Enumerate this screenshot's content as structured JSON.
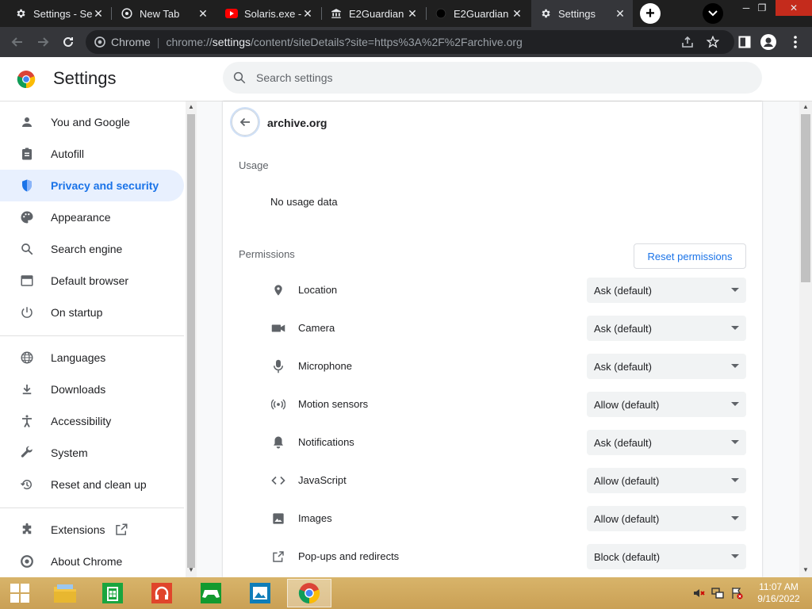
{
  "tabs": [
    {
      "title": "Settings - Se",
      "icon": "gear-icon"
    },
    {
      "title": "New Tab",
      "icon": "chrome-icon"
    },
    {
      "title": "Solaris.exe -",
      "icon": "youtube-icon"
    },
    {
      "title": "E2Guardian",
      "icon": "bank-icon"
    },
    {
      "title": "E2Guardian",
      "icon": "github-icon"
    },
    {
      "title": "Settings",
      "icon": "gear-icon"
    }
  ],
  "omnibox": {
    "badge": "Chrome",
    "url_prefix": "chrome://",
    "url_host": "settings",
    "url_rest": "/content/siteDetails?site=https%3A%2F%2Farchive.org"
  },
  "header": {
    "title": "Settings",
    "search_placeholder": "Search settings"
  },
  "sidebar": {
    "items": [
      {
        "label": "You and Google",
        "icon": "person-icon"
      },
      {
        "label": "Autofill",
        "icon": "clipboard-icon"
      },
      {
        "label": "Privacy and security",
        "icon": "shield-icon"
      },
      {
        "label": "Appearance",
        "icon": "palette-icon"
      },
      {
        "label": "Search engine",
        "icon": "search-icon"
      },
      {
        "label": "Default browser",
        "icon": "browser-icon"
      },
      {
        "label": "On startup",
        "icon": "power-icon"
      },
      {
        "label": "Languages",
        "icon": "globe-icon"
      },
      {
        "label": "Downloads",
        "icon": "download-icon"
      },
      {
        "label": "Accessibility",
        "icon": "accessibility-icon"
      },
      {
        "label": "System",
        "icon": "wrench-icon"
      },
      {
        "label": "Reset and clean up",
        "icon": "history-icon"
      },
      {
        "label": "Extensions",
        "icon": "puzzle-icon"
      },
      {
        "label": "About Chrome",
        "icon": "chrome-icon"
      }
    ],
    "selected": "Privacy and security"
  },
  "site": {
    "name": "archive.org"
  },
  "usage": {
    "title": "Usage",
    "text": "No usage data"
  },
  "permissions": {
    "title": "Permissions",
    "reset_label": "Reset permissions",
    "items": [
      {
        "label": "Location",
        "value": "Ask (default)",
        "icon": "location-pin-icon"
      },
      {
        "label": "Camera",
        "value": "Ask (default)",
        "icon": "camera-icon"
      },
      {
        "label": "Microphone",
        "value": "Ask (default)",
        "icon": "microphone-icon"
      },
      {
        "label": "Motion sensors",
        "value": "Allow (default)",
        "icon": "sensors-icon"
      },
      {
        "label": "Notifications",
        "value": "Ask (default)",
        "icon": "bell-icon"
      },
      {
        "label": "JavaScript",
        "value": "Allow (default)",
        "icon": "code-icon"
      },
      {
        "label": "Images",
        "value": "Allow (default)",
        "icon": "image-icon"
      },
      {
        "label": "Pop-ups and redirects",
        "value": "Block (default)",
        "icon": "open-in-new-icon"
      }
    ]
  },
  "taskbar": {
    "time": "11:07 AM",
    "date": "9/16/2022"
  },
  "colors": {
    "accent": "#1a73e8",
    "selected_bg": "#e8f0fe",
    "tabstrip": "#1f1f1f",
    "toolbar": "#35363a"
  }
}
